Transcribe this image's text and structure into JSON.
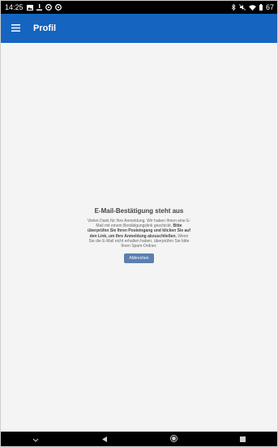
{
  "status_bar": {
    "time": "14:25",
    "battery": "67"
  },
  "app_bar": {
    "title": "Profil",
    "menu_icon": "hamburger-menu-icon"
  },
  "card": {
    "title": "E-Mail-Bestätigung steht aus",
    "text_part1": "Vielen Dank für Ihre Anmeldung. Wir haben Ihnen eine E-Mail mit einem Bestätigungslink geschickt. ",
    "text_bold": "Bitte überprüfen Sie Ihren Posteingang und klicken Sie auf den Link, um Ihre Anmeldung abzuschließen.",
    "text_part2": " Wenn Sie die E-Mail nicht erhalten haben, überprüfen Sie bitte Ihren Spam-Ordner.",
    "cancel_label": "Abbrechen"
  },
  "colors": {
    "app_bar": "#1565c0",
    "button": "#5b7fb0",
    "content_bg": "#f4f4f4"
  }
}
